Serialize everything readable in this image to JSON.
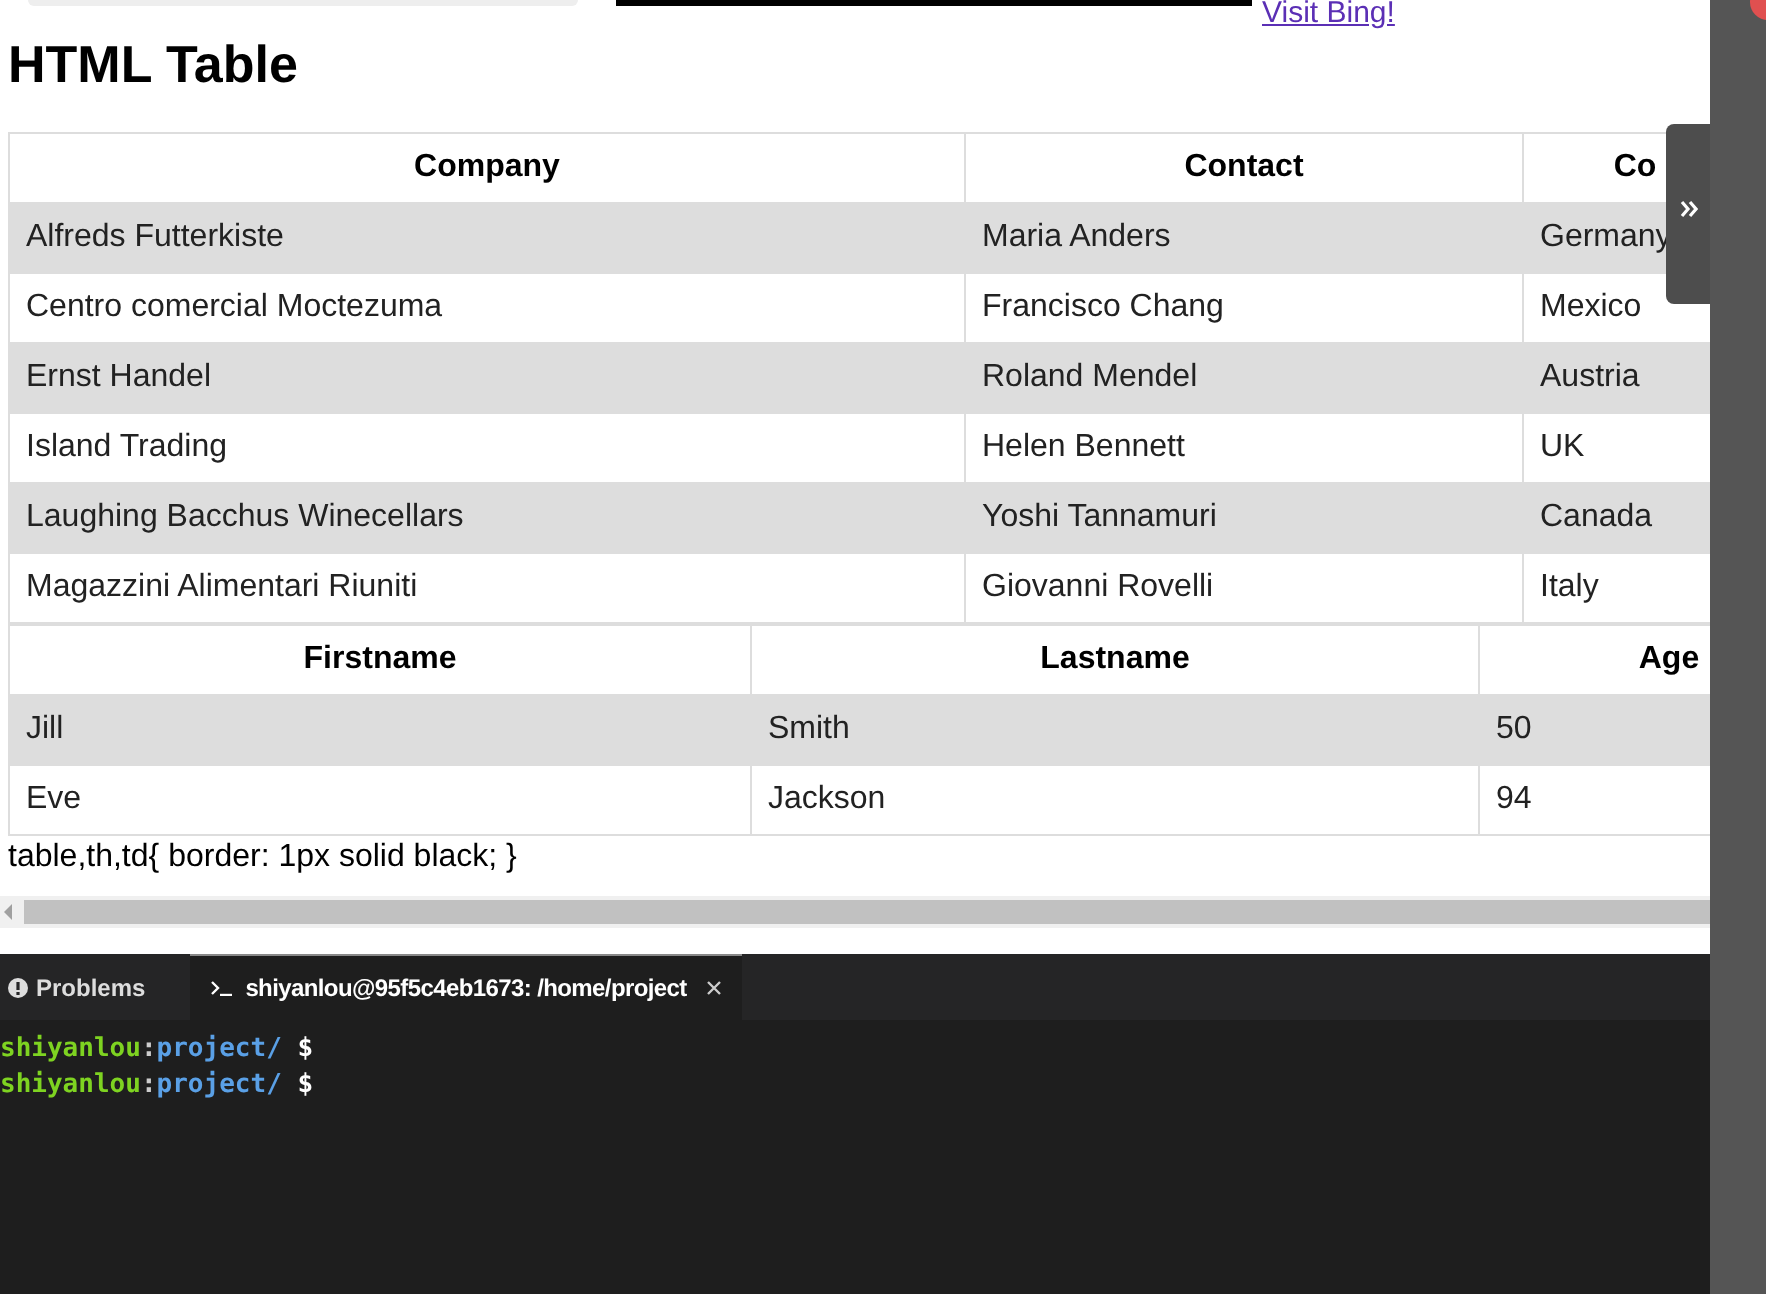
{
  "top_link": "Visit Bing!",
  "heading": "HTML Table",
  "table_1": {
    "columns": [
      "Company",
      "Contact",
      "Co"
    ],
    "rows": [
      [
        "Alfreds Futterkiste",
        "Maria Anders",
        "Germany"
      ],
      [
        "Centro comercial Moctezuma",
        "Francisco Chang",
        "Mexico"
      ],
      [
        "Ernst Handel",
        "Roland Mendel",
        "Austria"
      ],
      [
        "Island Trading",
        "Helen Bennett",
        "UK"
      ],
      [
        "Laughing Bacchus Winecellars",
        "Yoshi Tannamuri",
        "Canada"
      ],
      [
        "Magazzini Alimentari Riuniti",
        "Giovanni Rovelli",
        "Italy"
      ]
    ]
  },
  "table_2": {
    "columns": [
      "Firstname",
      "Lastname",
      "Age"
    ],
    "rows": [
      [
        "Jill",
        "Smith",
        "50"
      ],
      [
        "Eve",
        "Jackson",
        "94"
      ]
    ]
  },
  "css_text": "table,th,td{ border: 1px solid black; }",
  "panel_tabs": [
    {
      "label": "Problems",
      "selected": false
    },
    {
      "label": "shiyanlou@95f5c4eb1673: /home/project",
      "selected": true
    }
  ],
  "terminal_lines": [
    {
      "user": "shiyanlou",
      "separator": ":",
      "path": "project/",
      "prompt": "$"
    },
    {
      "user": "shiyanlou",
      "separator": ":",
      "path": "project/",
      "prompt": "$"
    }
  ]
}
